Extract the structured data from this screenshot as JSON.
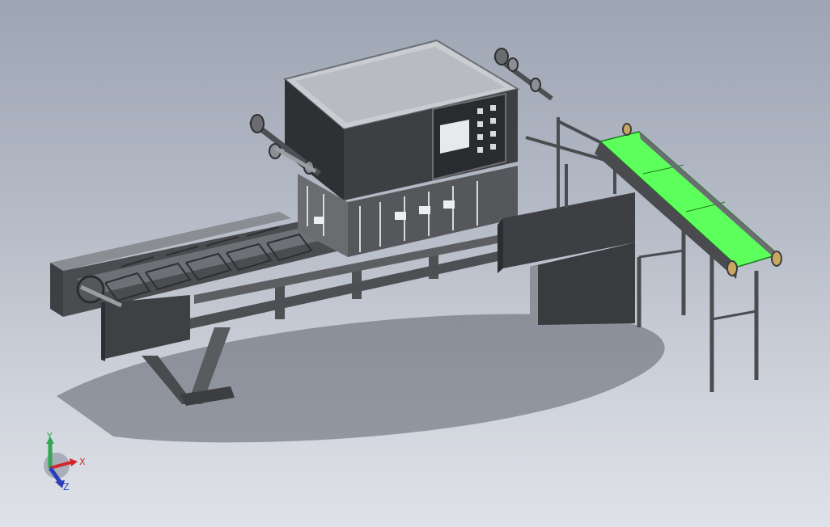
{
  "triad": {
    "x_label": "X",
    "y_label": "Y",
    "z_label": "Z",
    "colors": {
      "x": "#d2262a",
      "y": "#2fa84f",
      "z": "#2a3fb8"
    }
  },
  "colors": {
    "background_top": "#9ea5b3",
    "background_bottom": "#dfe2e8",
    "frame_dark": "#3a3b3e",
    "frame_mid": "#5b5d61",
    "frame_light": "#8e9196",
    "housing_top": "#c9ccd1",
    "conveyor_belt": "#5dff5d",
    "shadow": "#5b606b"
  }
}
